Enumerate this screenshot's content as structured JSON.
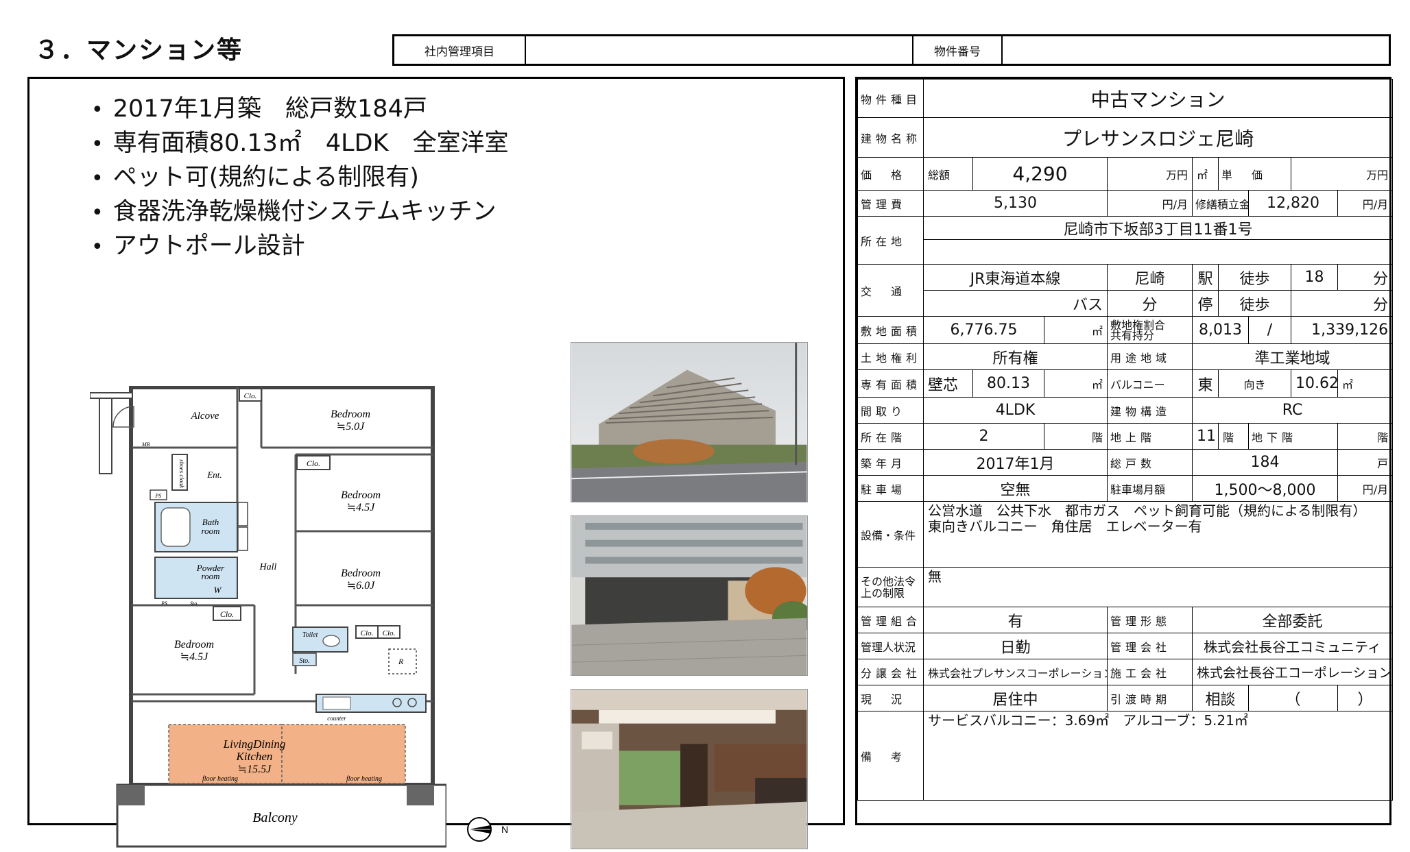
{
  "section_title": "３．マンション等",
  "mgmt_bar": {
    "label1": "社内管理項目",
    "label2": "物件番号"
  },
  "highlights": [
    "2017年1月築　総戸数184戸",
    "専有面積80.13㎡　4LDK　全室洋室",
    "ペット可(規約による制限有)",
    "食器洗浄乾燥機付システムキッチン",
    "アウトポール設計"
  ],
  "floorplan": {
    "alcove": "Alcove",
    "mb": "MB",
    "clo": "Clo.",
    "bedroom": "Bedroom",
    "b1": "≒5.0J",
    "b2": "≒4.5J",
    "b3": "≒6.0J",
    "b4": "≒4.5J",
    "shoes": "shoes cloak",
    "ent": "Ent.",
    "ps": "PS",
    "bath": "Bath",
    "room": "room",
    "sto": "Sto.",
    "hall": "Hall",
    "powder": "Powder",
    "w": "W",
    "toilet": "Toilet",
    "r": "R",
    "counter": "counter",
    "ldk1": "LivingDining",
    "ldk2": "Kitchen",
    "ldk3": "≒15.5J",
    "floor_heating": "floor heating",
    "balcony": "Balcony",
    "north": "N"
  },
  "spec": {
    "type_h": "物件種目",
    "type_v": "中古マンション",
    "name_h": "建物名称",
    "name_v": "プレサンスロジェ尼崎",
    "price_h": "価　格",
    "total": "総額",
    "price_v": "4,290",
    "man": "万円",
    "m2": "㎡",
    "unit_h": "単　価",
    "unit_man": "万円",
    "fee_h": "管理費",
    "fee_v": "5,130",
    "per_month": "円/月",
    "repair_h": "修繕積立金",
    "repair_v": "12,820",
    "addr_h": "所在地",
    "addr_v": "尼崎市下坂部3丁目11番1号",
    "traffic_h": "交　通",
    "line": "JR東海道本線",
    "station": "尼崎",
    "eki": "駅",
    "toho": "徒歩",
    "walk": "18",
    "fun": "分",
    "bus": "バス",
    "tei": "停",
    "land_area_h": "敷地面積",
    "land_area_v": "6,776.75",
    "share_h1": "敷地権割合",
    "share_h2": "共有持分",
    "share_n": "8,013",
    "slash": "/",
    "share_d": "1,339,126",
    "right_h": "土地権利",
    "right_v": "所有権",
    "zone_h": "用途地域",
    "zone_v": "準工業地域",
    "area_h": "専有面積",
    "hekishin": "壁芯",
    "area_v": "80.13",
    "balcony_h": "バルコニー",
    "dir": "東",
    "muki": "向き",
    "balc_v": "10.62",
    "layout_h": "間取り",
    "layout_v": "4LDK",
    "struct_h": "建物構造",
    "struct_v": "RC",
    "floor_h": "所在階",
    "floor_v": "2",
    "kai": "階",
    "above_h": "地上階",
    "above_v": "11",
    "below_h": "地下階",
    "built_h": "築年月",
    "built_v": "2017年1月",
    "units_h": "総戸数",
    "units_v": "184",
    "ko": "戸",
    "parking_h": "駐車場",
    "parking_v": "空無",
    "pfee_h": "駐車場月額",
    "pfee_v": "1,500〜8,000",
    "equip_h": "設備・条件",
    "equip_v1": "公営水道　公共下水　都市ガス　ペット飼育可能（規約による制限有）",
    "equip_v2": "東向きバルコニー　角住居　エレベーター有",
    "law_h1": "その他法令",
    "law_h2": "上の制限",
    "law_v": "無",
    "assoc_h": "管理組合",
    "assoc_v": "有",
    "form_h": "管理形態",
    "form_v": "全部委託",
    "staff_h": "管理人状況",
    "staff_v": "日勤",
    "company_h": "管理会社",
    "company_v": "株式会社長谷工コミュニティ",
    "seller_h": "分譲会社",
    "seller_v": "株式会社プレサンスコーポレーション",
    "builder_h": "施工会社",
    "builder_v": "株式会社長谷工コーポレーション",
    "status_h": "現　況",
    "status_v": "居住中",
    "handover_h": "引渡時期",
    "handover_v": "相談",
    "paren_l": "（",
    "paren_r": "）",
    "notes_h": "備　考",
    "notes_v": "サービスバルコニー：3.69㎡　アルコーブ：5.21㎡"
  },
  "colors": {
    "bath": "#cfe4f3",
    "ldk": "#f2b187",
    "wall": "#444444"
  }
}
